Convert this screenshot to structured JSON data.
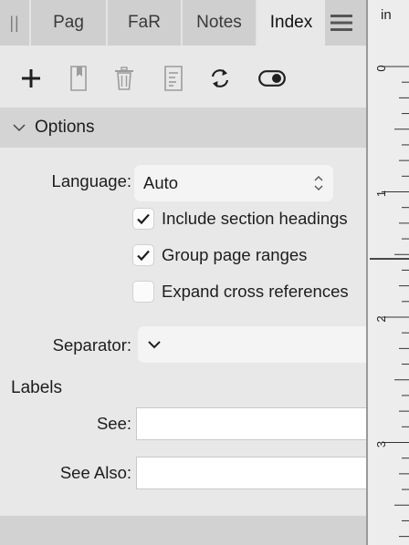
{
  "tabs": {
    "grip": "||",
    "items": [
      "Pag",
      "FaR",
      "Notes",
      "Index"
    ],
    "active_index": 3
  },
  "toolbar": {
    "icons": [
      "plus-icon",
      "bookmark-page-icon",
      "trash-icon",
      "document-list-icon",
      "refresh-icon",
      "toggle-icon"
    ]
  },
  "options": {
    "title": "Options",
    "language": {
      "label": "Language:",
      "value": "Auto"
    },
    "checkboxes": [
      {
        "label": "Include section headings",
        "checked": true
      },
      {
        "label": "Group page ranges",
        "checked": true
      },
      {
        "label": "Expand cross references",
        "checked": false
      }
    ],
    "separator": {
      "label": "Separator:",
      "value": ""
    }
  },
  "labels": {
    "title": "Labels",
    "see": {
      "label": "See:",
      "value": ""
    },
    "see_also": {
      "label": "See Also:",
      "value": ""
    }
  },
  "ruler": {
    "unit": "in",
    "ticks": [
      "0",
      "1",
      "2",
      "3"
    ]
  },
  "colors": {
    "panel_bg": "#e8e8e8",
    "tabbar_bg": "#cfcfcf",
    "section_header_bg": "#d4d4d4",
    "icon_dark": "#1f1f1f",
    "icon_disabled": "#9c9c9c"
  }
}
